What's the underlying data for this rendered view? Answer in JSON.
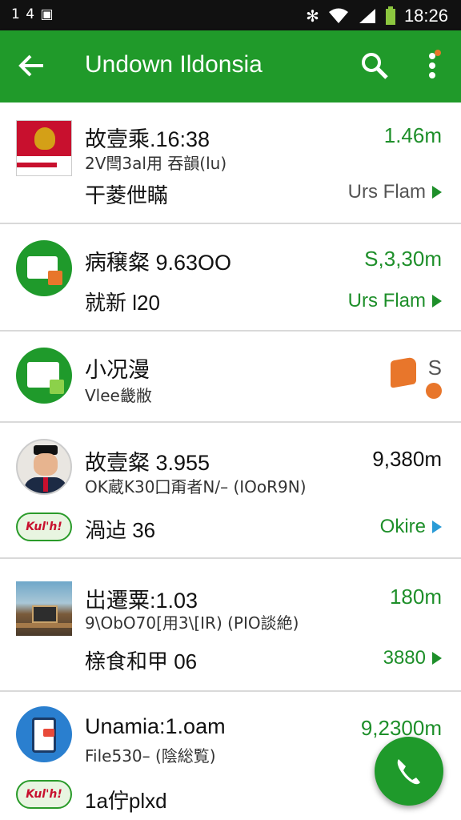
{
  "status_bar": {
    "left_text": "1 4 ▣",
    "time": "18:26"
  },
  "app_bar": {
    "title": "Undown Ildonsia"
  },
  "rows": [
    {
      "name": "故壹乘.16:38",
      "sub": "2V閆3al用 吞韻(lu)",
      "third": "干菱伳瞞",
      "amount": "1.46m",
      "action": "Urs Flam"
    },
    {
      "name": "病穣粲 9.63OO",
      "third": "就新 l20",
      "amount": "S,3,30m",
      "action": "Urs Flam"
    },
    {
      "name": "小况漫",
      "sub": "Vlee畿敝",
      "amount": "S"
    },
    {
      "name": "故壹粲 3.955",
      "sub": "OK蔵K30囗甭者N/– (IOoR9N)",
      "third": "渦迠 36",
      "amount": "9,380m",
      "action": "Okire",
      "logo": "Kul'h!"
    },
    {
      "name": "岀遷粟:1.03",
      "sub": "9\\ObO70[用3\\[IR) (PIO談絶)",
      "third": "榇食和甲 06",
      "amount": "180m",
      "action": "3880"
    },
    {
      "name": "Unamia:1.oam",
      "sub": "File530– (陰総覧)",
      "third": "1a佇plxd",
      "amount": "9,2300m",
      "logo": "Kul'h!"
    }
  ],
  "colors": {
    "primary": "#209a2a",
    "accent": "#e8762b"
  }
}
